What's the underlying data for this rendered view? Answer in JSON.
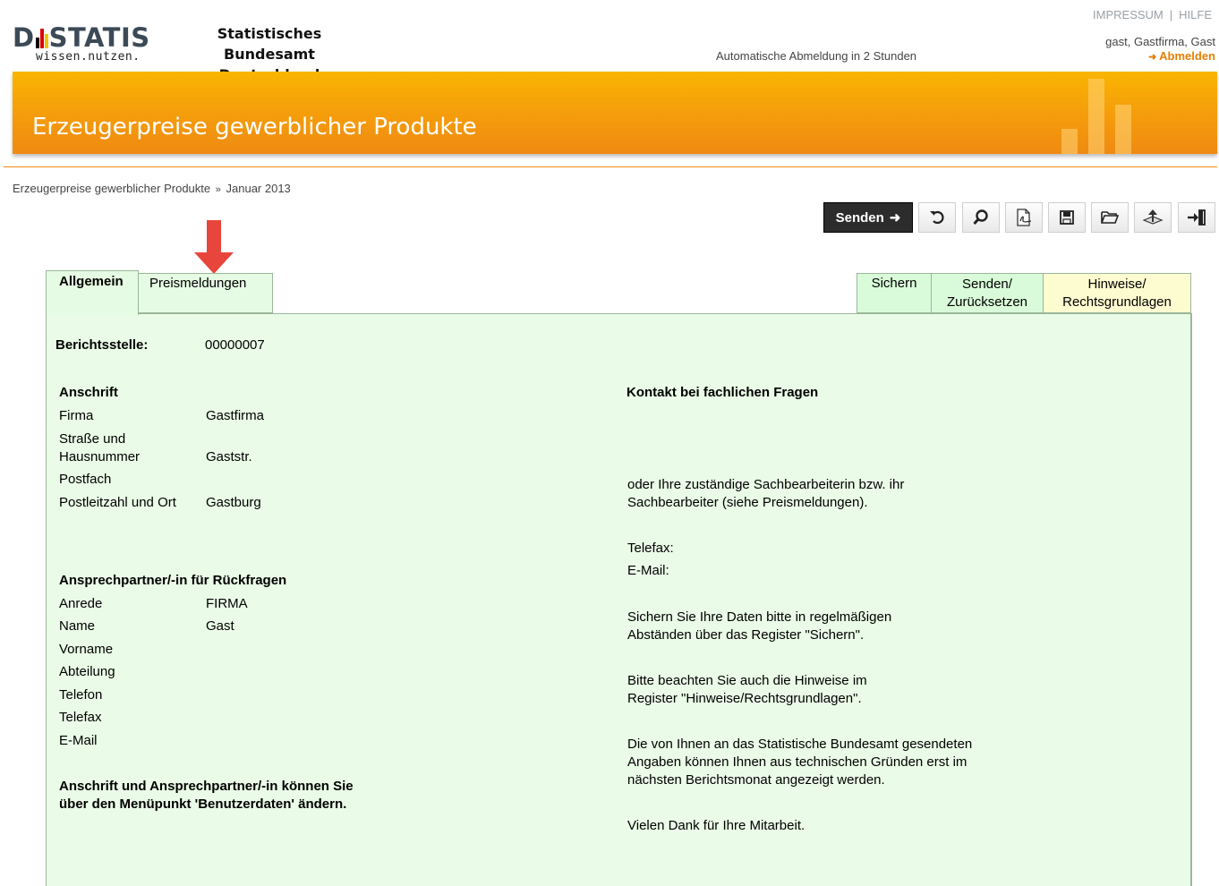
{
  "header": {
    "logo_text_a": "D",
    "logo_text_b": "STATIS",
    "logo_tagline": "wissen.nutzen.",
    "agency_line1": "Statistisches Bundesamt",
    "agency_line2": "Deutschland",
    "impressum": "IMPRESSUM",
    "separator": "|",
    "hilfe": "HILFE",
    "user": "gast, Gastfirma, Gast",
    "logout_arrow": "➜",
    "logout": "Abmelden",
    "autologout": "Automatische Abmeldung in 2 Stunden"
  },
  "banner": {
    "title": "Erzeugerpreise gewerblicher Produkte"
  },
  "breadcrumb": {
    "item1": "Erzeugerpreise gewerblicher Produkte",
    "sep": "»",
    "item2": "Januar 2013"
  },
  "toolbar": {
    "send_label": "Senden",
    "send_arrow": "➜",
    "icons": [
      "undo-icon",
      "search-icon",
      "pdf-print-icon",
      "save-icon",
      "open-folder-icon",
      "upload-icon",
      "exit-icon"
    ]
  },
  "tabs": {
    "allgemein": "Allgemein",
    "preismeldungen": "Preismeldungen",
    "sichern": "Sichern",
    "senden_l1": "Senden/",
    "senden_l2": "Zurücksetzen",
    "hinweise_l1": "Hinweise/",
    "hinweise_l2": "Rechtsgrundlagen"
  },
  "left": {
    "berichtsstelle_label": "Berichtsstelle:",
    "berichtsstelle_value": "00000007",
    "anschrift_heading": "Anschrift",
    "firma_label": "Firma",
    "firma_value": "Gastfirma",
    "strasse_label_l1": "Straße und",
    "strasse_label_l2": "Hausnummer",
    "strasse_value": "Gaststr.",
    "postfach_label": "Postfach",
    "plz_label": "Postleitzahl und Ort",
    "plz_value": "Gastburg",
    "ansprech_heading": "Ansprechpartner/-in für Rückfragen",
    "anrede_label": "Anrede",
    "anrede_value": "FIRMA",
    "name_label": "Name",
    "name_value": "Gast",
    "vorname_label": "Vorname",
    "abteilung_label": "Abteilung",
    "telefon_label": "Telefon",
    "telefax_label": "Telefax",
    "email_label": "E-Mail",
    "note_l1": "Anschrift und Ansprechpartner/-in können Sie",
    "note_l2": "über den Menüpunkt 'Benutzerdaten' ändern."
  },
  "right": {
    "kontakt_heading": "Kontakt bei fachlichen Fragen",
    "p1_l1": "oder Ihre zuständige Sachbearbeiterin bzw. ihr",
    "p1_l2": "Sachbearbeiter (siehe Preismeldungen).",
    "telefax_label": "Telefax:",
    "email_label": "E-Mail:",
    "p2_l1": "Sichern Sie Ihre Daten bitte in regelmäßigen",
    "p2_l2": "Abständen über das Register \"Sichern\".",
    "p3_l1": "Bitte beachten Sie auch die Hinweise im",
    "p3_l2": "Register \"Hinweise/Rechtsgrundlagen\".",
    "p4_l1": "Die von Ihnen an das Statistische Bundesamt gesendeten",
    "p4_l2": "Angaben können Ihnen aus technischen Gründen erst im",
    "p4_l3": "nächsten Berichtsmonat angezeigt werden.",
    "p5": "Vielen Dank für Ihre Mitarbeit."
  },
  "colors": {
    "banner": "#f6a20a",
    "panel": "#eafbe7",
    "accent": "#e67e00",
    "arrow": "#e8463c"
  }
}
